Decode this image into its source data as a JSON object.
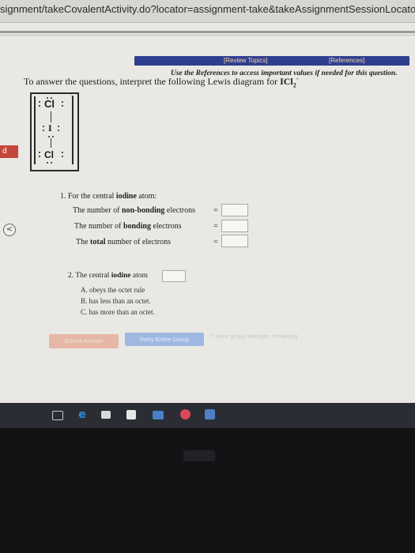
{
  "address_bar": {
    "url": "signment/takeCovalentActivity.do?locator=assignment-take&takeAssignmentSessionLocator=assignmen"
  },
  "nav": {
    "review_topics": "[Review Topics]",
    "references": "[References]"
  },
  "reference_note": "Use the References to access important values if needed for this question.",
  "intro": {
    "text": "To answer the questions, interpret the following Lewis diagram for ",
    "formula_main": "ICl",
    "formula_sub": "2",
    "formula_charge": "-"
  },
  "lewis": {
    "charge": "-",
    "atom_top": "Cl",
    "atom_center": "I",
    "atom_bottom": "Cl"
  },
  "sidebar": {
    "red_tab_label": "d",
    "circle_label": "<"
  },
  "question1": {
    "heading_prefix": "1. For the central ",
    "heading_bold": "iodine",
    "heading_suffix": " atom:",
    "row1_prefix": "The number of ",
    "row1_bold": "non-bonding",
    "row1_suffix": " electrons",
    "row2_prefix": "The number of ",
    "row2_bold": "bonding",
    "row2_suffix": " electrons",
    "row3_prefix": "The ",
    "row3_bold": "total",
    "row3_suffix": " number of electrons",
    "equals": "=",
    "answer1": "",
    "answer2": "",
    "answer3": ""
  },
  "question2": {
    "heading_prefix": "2. The central ",
    "heading_bold": "iodine",
    "heading_suffix": " atom",
    "answer": "",
    "option_a": "A. obeys the octet rule",
    "option_b": "B. has less than an octet.",
    "option_c": "C. has more than an octet."
  },
  "buttons": {
    "submit": "Submit Answer",
    "retry": "Retry Entire Group",
    "attempts": "7 more group attempts remaining"
  },
  "taskbar": {
    "icons": [
      "task-view-icon",
      "edge-icon",
      "store-icon",
      "calendar-icon",
      "files-icon",
      "chrome-icon",
      "app-icon"
    ]
  }
}
